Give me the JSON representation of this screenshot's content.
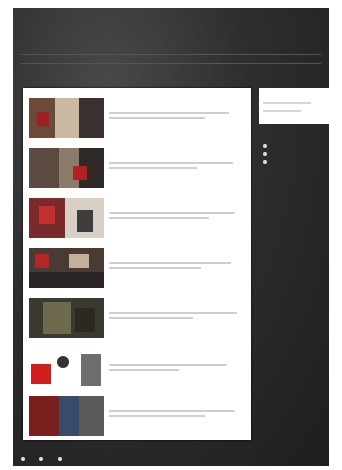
{
  "header": {
    "title_small": " ",
    "title": " "
  },
  "nav": {
    "items": [
      " ",
      " ",
      " ",
      " ",
      " ",
      " ",
      " "
    ]
  },
  "subnav": " ",
  "posts": [
    {
      "title": " "
    },
    {
      "title": " "
    },
    {
      "title": " "
    },
    {
      "title": " "
    },
    {
      "title": " "
    },
    {
      "title": " "
    },
    {
      "title": " "
    }
  ],
  "sidebar": {
    "box_title": " ",
    "heading": " ",
    "links": [
      " ",
      " ",
      " "
    ]
  },
  "footer": {
    "items": [
      " ",
      " ",
      " "
    ]
  },
  "colors": {
    "background": "#2e2e2e",
    "content": "#ffffff"
  }
}
